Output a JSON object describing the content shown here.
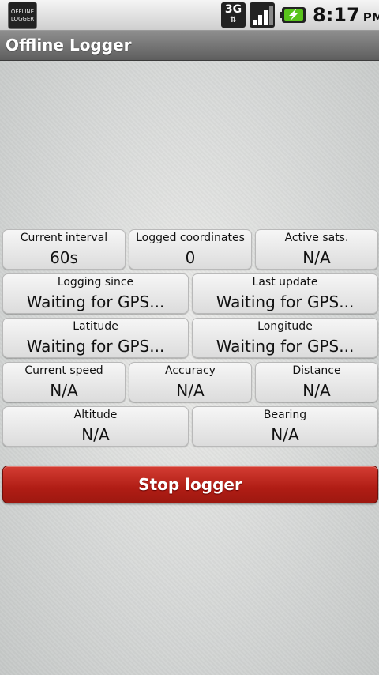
{
  "statusbar": {
    "notif_line1": "OFFLINE",
    "notif_line2": "LOGGER",
    "network": "3G",
    "time": "8:17",
    "ampm": "PM",
    "icons": [
      "app-notification-icon",
      "3g-data-icon",
      "signal-strength-icon",
      "battery-charging-icon"
    ]
  },
  "titlebar": {
    "title": "Offline Logger"
  },
  "stats": {
    "current_interval": {
      "label": "Current interval",
      "value": "60s"
    },
    "logged_coordinates": {
      "label": "Logged coordinates",
      "value": "0"
    },
    "active_sats": {
      "label": "Active sats.",
      "value": "N/A"
    },
    "logging_since": {
      "label": "Logging since",
      "value": "Waiting for GPS..."
    },
    "last_update": {
      "label": "Last update",
      "value": "Waiting for GPS..."
    },
    "latitude": {
      "label": "Latitude",
      "value": "Waiting for GPS..."
    },
    "longitude": {
      "label": "Longitude",
      "value": "Waiting for GPS..."
    },
    "current_speed": {
      "label": "Current speed",
      "value": "N/A"
    },
    "accuracy": {
      "label": "Accuracy",
      "value": "N/A"
    },
    "distance": {
      "label": "Distance",
      "value": "N/A"
    },
    "altitude": {
      "label": "Altitude",
      "value": "N/A"
    },
    "bearing": {
      "label": "Bearing",
      "value": "N/A"
    }
  },
  "actions": {
    "stop_label": "Stop logger"
  },
  "colors": {
    "stop_button": "#b01d15",
    "titlebar": "#6e6e6e"
  }
}
